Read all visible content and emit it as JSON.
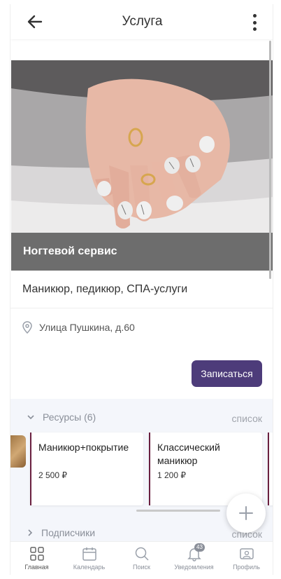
{
  "header": {
    "title": "Услуга"
  },
  "hero": {
    "caption": "Ногтевой сервис"
  },
  "service": {
    "subtitle": "Маникюр, педикюр, СПА-услуги",
    "address": "Улица Пушкина, д.60",
    "book_label": "Записаться"
  },
  "resources": {
    "heading": "Ресурсы (6)",
    "list_link": "список",
    "cards": [
      {
        "title": "Маникюр+покрытие",
        "price": "2 500 ₽"
      },
      {
        "title": "Классический маникюр",
        "price": "1 200 ₽"
      }
    ]
  },
  "subscribers": {
    "heading": "Подписчики",
    "list_link": "список"
  },
  "nav": {
    "items": [
      {
        "label": "Главная",
        "icon": "home-grid-icon"
      },
      {
        "label": "Календарь",
        "icon": "calendar-icon"
      },
      {
        "label": "Поиск",
        "icon": "search-icon"
      },
      {
        "label": "Уведомления",
        "icon": "bell-icon",
        "badge": "43"
      },
      {
        "label": "Профиль",
        "icon": "profile-card-icon"
      }
    ]
  },
  "colors": {
    "accent": "#4d3c7a",
    "card_stripe": "#6a1f3f",
    "section_bg": "#f4f6fb"
  }
}
